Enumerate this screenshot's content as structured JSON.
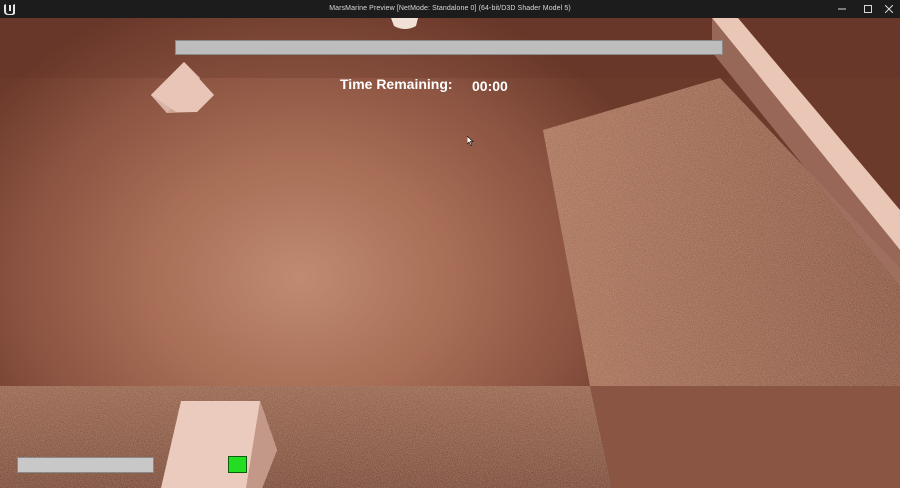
{
  "window": {
    "title": "MarsMarine Preview [NetMode: Standalone 0]  (64-bit/D3D Shader Model 5)",
    "logo_icon": "unreal-engine-logo-icon",
    "controls": [
      "minimize-icon",
      "maximize-icon",
      "close-icon"
    ]
  },
  "hud": {
    "timer_label": "Time Remaining:",
    "timer_value": "00:00",
    "top_bar_color": "#bdbdbd",
    "bottom_bar_color": "#c8c8c8",
    "status_indicator_color": "#22dd22"
  },
  "colors": {
    "ground": "#a86e56",
    "wall": "#e9c6b6",
    "titlebar": "#1c1c1c"
  }
}
